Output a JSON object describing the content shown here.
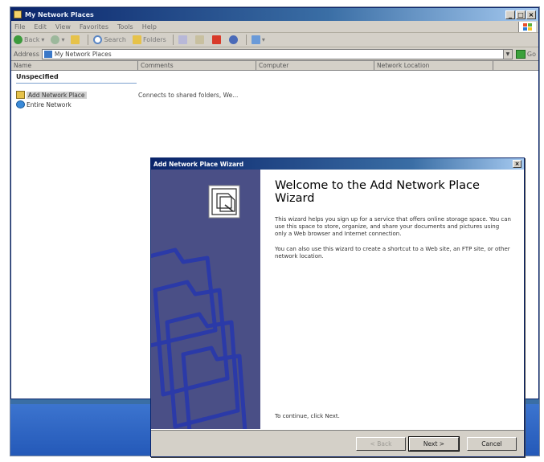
{
  "explorer": {
    "title": "My Network Places",
    "menu": [
      "File",
      "Edit",
      "View",
      "Favorites",
      "Tools",
      "Help"
    ],
    "toolbar": {
      "back": "Back",
      "search": "Search",
      "folders": "Folders"
    },
    "address": {
      "label": "Address",
      "value": "My Network Places",
      "go": "Go"
    },
    "columns": [
      "Name",
      "Comments",
      "Computer",
      "Network Location"
    ],
    "group": "Unspecified",
    "items": [
      {
        "name": "Add Network Place",
        "comment": "Connects to shared folders, We..."
      },
      {
        "name": "Entire Network",
        "comment": ""
      }
    ]
  },
  "wizard": {
    "title": "Add Network Place Wizard",
    "close": "×",
    "heading": "Welcome to the Add Network Place Wizard",
    "paragraph1": "This wizard helps you sign up for a service that offers online storage space. You can use this space to store, organize, and share your documents and pictures using only a Web browser and Internet connection.",
    "paragraph2": "You can also use this wizard to create a shortcut to a Web site, an FTP site, or other network location.",
    "continue_text": "To continue, click Next.",
    "buttons": {
      "back": "< Back",
      "next": "Next >",
      "cancel": "Cancel"
    }
  },
  "colors": {
    "titlebar": "#0a246a",
    "chrome": "#d4d0c8",
    "wizard_side": "#4a4f86",
    "desktop": "#3a6ea5"
  }
}
